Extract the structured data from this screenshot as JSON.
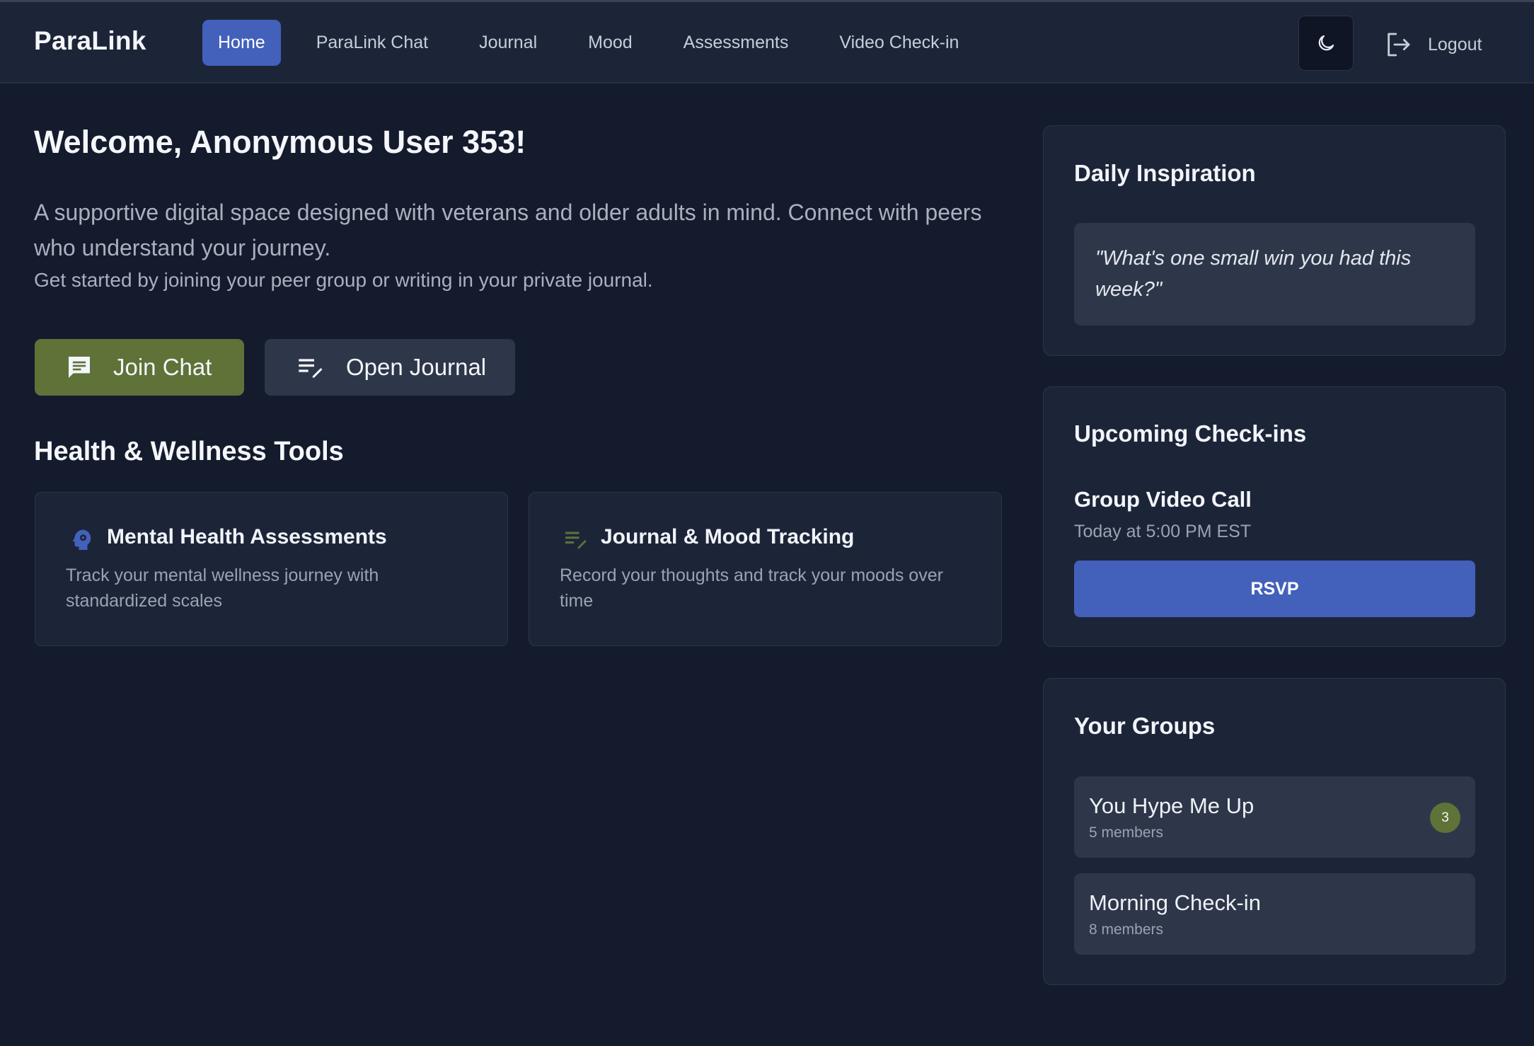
{
  "app": {
    "brand": "ParaLink"
  },
  "nav": {
    "tabs": [
      {
        "label": "Home",
        "active": true
      },
      {
        "label": "ParaLink Chat"
      },
      {
        "label": "Journal"
      },
      {
        "label": "Mood"
      },
      {
        "label": "Assessments"
      },
      {
        "label": "Video Check-in"
      }
    ],
    "theme_toggle_icon": "moon-icon",
    "logout_label": "Logout",
    "logout_icon": "logout-icon"
  },
  "main": {
    "welcome": "Welcome, Anonymous User 353!",
    "intro": "A supportive digital space designed with veterans and older adults in mind. Connect with peers who understand your journey.",
    "intro_sub": "Get started by joining your peer group or writing in your private journal.",
    "buttons": {
      "join_chat": {
        "label": "Join Chat",
        "icon": "chat-icon"
      },
      "open_journal": {
        "label": "Open Journal",
        "icon": "edit-note-icon"
      }
    },
    "tools_title": "Health & Wellness Tools",
    "tools": [
      {
        "title": "Mental Health Assessments",
        "description": "Track your mental wellness journey with standardized scales",
        "icon": "psychology-icon"
      },
      {
        "title": "Journal & Mood Tracking",
        "description": "Record your thoughts and track your moods over time",
        "icon": "edit-note-icon"
      }
    ]
  },
  "sidebar": {
    "inspiration": {
      "title": "Daily Inspiration",
      "quote": "\"What's one small win you had this week?\""
    },
    "checkins": {
      "title": "Upcoming Check-ins",
      "event_title": "Group Video Call",
      "event_time": "Today at 5:00 PM EST",
      "rsvp_label": "RSVP"
    },
    "groups": {
      "title": "Your Groups",
      "items": [
        {
          "name": "You Hype Me Up",
          "members": "5 members",
          "badge": "3"
        },
        {
          "name": "Morning Check-in",
          "members": "8 members"
        }
      ]
    }
  },
  "colors": {
    "background": "#141b2d",
    "navbar": "#1c2538",
    "card": "#1c2538",
    "accent_blue": "#4360bb",
    "accent_green": "#5f7238",
    "muted_panel": "#2e3749"
  }
}
